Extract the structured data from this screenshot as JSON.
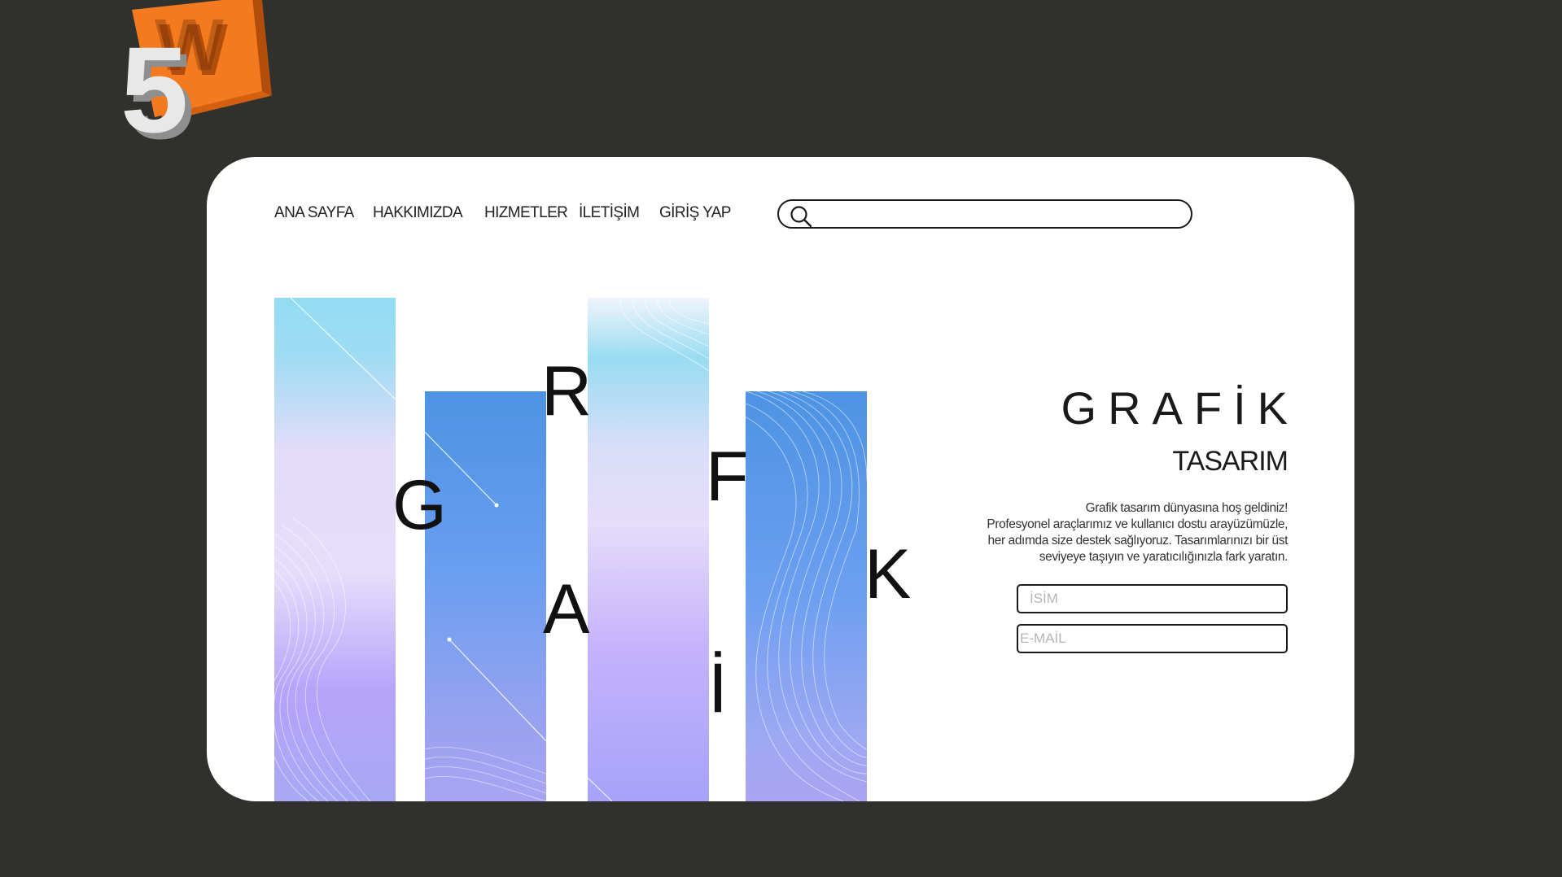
{
  "logo": {
    "number": "5",
    "letter": "W",
    "accent": "#f47a20"
  },
  "nav": {
    "items": [
      {
        "label": "ANA SAYFA"
      },
      {
        "label": "HAKKIMIZDA"
      },
      {
        "label": "HIZMETLER"
      },
      {
        "label": "İLETİŞİM"
      },
      {
        "label": "GİRİŞ YAP"
      }
    ]
  },
  "search": {
    "value": "",
    "icon": "search-icon"
  },
  "graphic_letters": [
    "G",
    "R",
    "A",
    "F",
    "İ",
    "K"
  ],
  "hero": {
    "title": "GRAFİK",
    "subtitle": "TASARIM",
    "description_lines": [
      "Grafik tasarım dünyasına hoş geldiniz!",
      "Profesyonel araçlarımız ve kullanıcı dostu arayüzümüzle,",
      "her adımda size destek sağlıyoruz. Tasarımlarınızı bir üst",
      "seviyeye taşıyın ve yaratıcılığınızla fark yaratın."
    ]
  },
  "form": {
    "name_placeholder": "İSİM",
    "email_placeholder": "E-MAİL"
  },
  "colors": {
    "background": "#30302c",
    "card": "#ffffff",
    "text": "#1a1a1a"
  }
}
